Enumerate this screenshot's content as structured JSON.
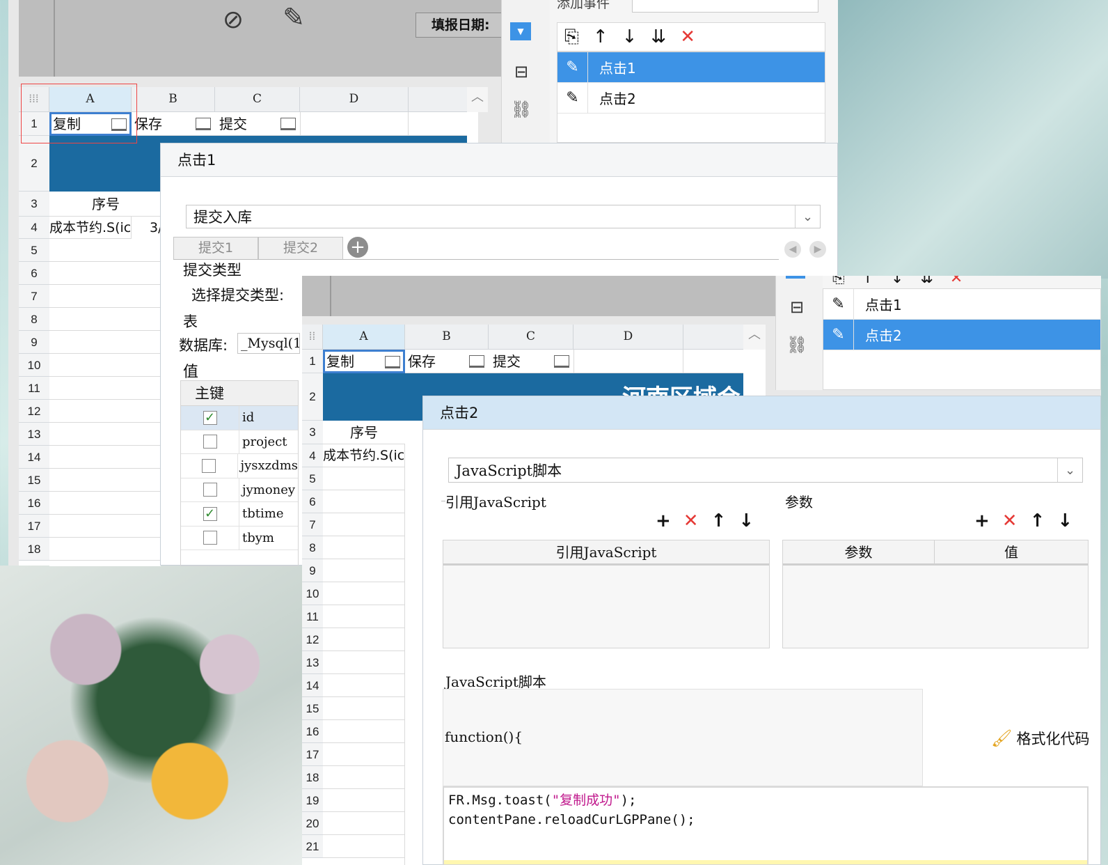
{
  "w1": {
    "fill_date_label": "填报日期:",
    "add_event_label": "添加事件",
    "columns": [
      "A",
      "B",
      "C",
      "D"
    ],
    "row1": [
      "复制",
      "保存",
      "提交"
    ],
    "rows": [
      "1",
      "2",
      "3",
      "4",
      "5",
      "6",
      "7",
      "8",
      "9",
      "10",
      "11",
      "12",
      "13",
      "14",
      "15",
      "16",
      "17",
      "18"
    ],
    "seq_label": "序号",
    "row4_a": "成本节约.S(ic",
    "row4_b": "3/",
    "events": [
      "点击1",
      "点击2"
    ],
    "panel": {
      "title": "点击1",
      "select_value": "提交入库",
      "tabs": [
        "提交1",
        "提交2"
      ],
      "submit_type_section": "提交类型",
      "choose_type_label": "选择提交类型:",
      "table_section": "表",
      "database_label": "数据库:",
      "database_value": "_Mysql(1",
      "value_section": "值",
      "pk_header": "主键",
      "fields": [
        {
          "name": "id",
          "checked": true
        },
        {
          "name": "project",
          "checked": false
        },
        {
          "name": "jysxzdms",
          "checked": false
        },
        {
          "name": "jymoney",
          "checked": false
        },
        {
          "name": "tbtime",
          "checked": true
        },
        {
          "name": "tbym",
          "checked": false
        }
      ]
    }
  },
  "w2": {
    "columns": [
      "A",
      "B",
      "C",
      "D"
    ],
    "row1": [
      "复制",
      "保存",
      "提交"
    ],
    "rows": [
      "1",
      "2",
      "3",
      "4",
      "5",
      "6",
      "7",
      "8",
      "9",
      "10",
      "11",
      "12",
      "13",
      "14",
      "15",
      "16",
      "17",
      "18",
      "19",
      "20",
      "21"
    ],
    "banner_text": "河南区域会",
    "seq_label": "序号",
    "row4_a": "成本节约.S(ic",
    "events": [
      "点击1",
      "点击2"
    ],
    "panel": {
      "title": "点击2",
      "select_value": "JavaScript脚本",
      "ref_js_section": "引用JavaScript",
      "params_section": "参数",
      "ref_js_header": "引用JavaScript",
      "param_header": "参数",
      "value_header": "值",
      "js_section": "JavaScript脚本",
      "function_sig": "function(){",
      "format_label": "格式化代码",
      "code_line1_a": "FR.Msg.toast(",
      "code_line1_str": "\"复制成功\"",
      "code_line1_b": ");",
      "code_line2": "contentPane.reloadCurLGPPane();"
    }
  },
  "icons": {
    "add": "plus-icon",
    "delete": "x-icon",
    "up": "arrow-up-icon",
    "down": "arrow-down-icon",
    "edit": "pencil-icon",
    "copy": "copy-icon",
    "link": "link-icon",
    "broom": "broom-icon"
  },
  "colors": {
    "selection": "#3d93e6",
    "banner": "#1b6aa0",
    "delete": "#e53935",
    "string": "#c0188c"
  }
}
